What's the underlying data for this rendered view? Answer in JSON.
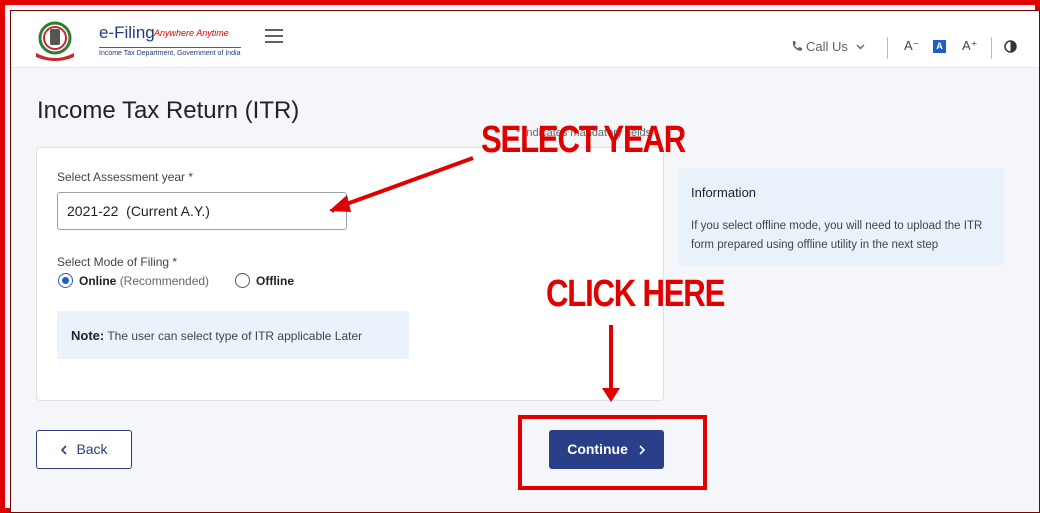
{
  "header": {
    "logo_title": "e-Filing",
    "logo_tagline": "Anywhere Anytime",
    "logo_subtitle": "Income Tax Department, Government of India",
    "call_us": "Call Us",
    "font_decrease": "A⁻",
    "font_normal": "A",
    "font_increase": "A⁺"
  },
  "page": {
    "title": "Income Tax Return (ITR)",
    "indicates_mandatory": "* Indicates mandatory fields"
  },
  "form": {
    "assessment_year_label": "Select Assessment year *",
    "assessment_year_value": "2021-22  (Current A.Y.)",
    "mode_label": "Select Mode of Filing *",
    "mode_online_label": "Online",
    "mode_online_hint": "(Recommended)",
    "mode_offline_label": "Offline",
    "selected_mode": "Online",
    "note_label": "Note:",
    "note_text": "The user can select type of ITR applicable Later"
  },
  "info": {
    "title": "Information",
    "text": "If you select offline mode, you will need to upload the ITR form prepared using offline utility in the next step"
  },
  "actions": {
    "back_label": "Back",
    "continue_label": "Continue"
  },
  "annotations": {
    "select_year": "SELECT YEAR",
    "click_here": "CLICK HERE",
    "color": "#e00000"
  },
  "icons": {
    "phone": "phone-icon",
    "chevron_down": "chevron-down-icon",
    "contrast": "contrast-icon",
    "menu": "hamburger-menu-icon",
    "back": "chevron-left-icon",
    "continue": "chevron-right-icon"
  }
}
